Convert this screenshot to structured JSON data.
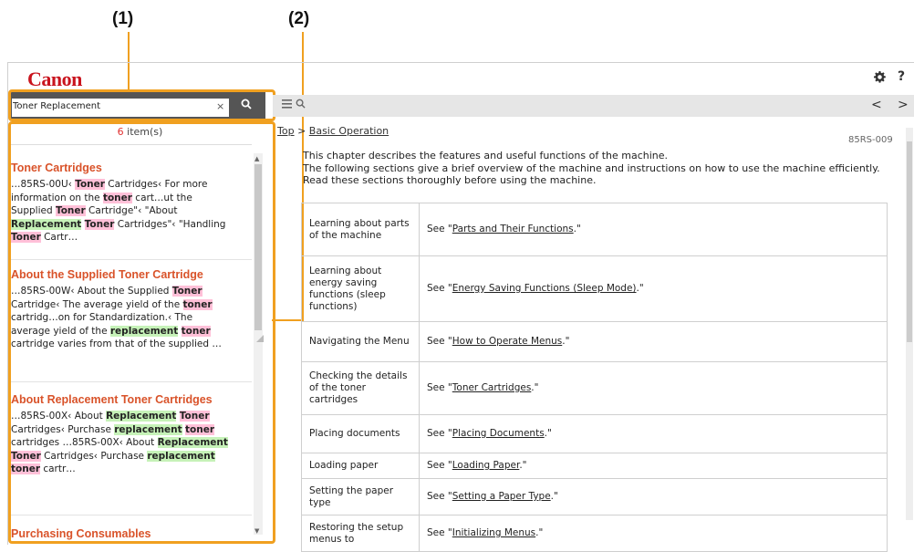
{
  "callouts": {
    "one": "(1)",
    "two": "(2)"
  },
  "header": {
    "logo": "Canon",
    "settings_icon": "gear-icon",
    "help_label": "?"
  },
  "search": {
    "value": "Toner Replacement",
    "clear_label": "×",
    "button_icon": "search-icon"
  },
  "toolbar": {
    "list_icon": "list-icon",
    "search_icon": "search-icon",
    "prev_label": "<",
    "next_label": ">"
  },
  "results": {
    "count": "6",
    "count_suffix": " item(s)",
    "items": [
      {
        "title": "Toner Cartridges",
        "snippet": [
          [
            "…85RS-00U‹ ",
            ""
          ],
          [
            "Toner",
            "t"
          ],
          [
            " Cartridges‹ For more information on the ",
            ""
          ],
          [
            "toner",
            "t"
          ],
          [
            " cart…ut the Supplied ",
            ""
          ],
          [
            "Toner",
            "t"
          ],
          [
            " Cartridge\"‹ \"About ",
            ""
          ],
          [
            "Replacement",
            "r"
          ],
          [
            " ",
            ""
          ],
          [
            "Toner",
            "t"
          ],
          [
            " Cartridges\"‹ \"Handling ",
            ""
          ],
          [
            "Toner",
            "t"
          ],
          [
            " Cartr…",
            ""
          ]
        ]
      },
      {
        "title": "About the Supplied Toner Cartridge",
        "snippet": [
          [
            "…85RS-00W‹ About the Supplied ",
            ""
          ],
          [
            "Toner",
            "t"
          ],
          [
            " Cartridge‹ The average yield of the ",
            ""
          ],
          [
            "toner",
            "t"
          ],
          [
            " cartridg…on for Standardization.‹ The average yield of the ",
            ""
          ],
          [
            "replacement",
            "r"
          ],
          [
            " ",
            ""
          ],
          [
            "toner",
            "t"
          ],
          [
            " cartridge varies from that of the supplied …",
            ""
          ]
        ]
      },
      {
        "title": "About Replacement Toner Cartridges",
        "snippet": [
          [
            "…85RS-00X‹ About ",
            ""
          ],
          [
            "Replacement",
            "r"
          ],
          [
            " ",
            ""
          ],
          [
            "Toner",
            "t"
          ],
          [
            " Cartridges‹ Purchase ",
            ""
          ],
          [
            "replacement",
            "r"
          ],
          [
            " ",
            ""
          ],
          [
            "toner",
            "t"
          ],
          [
            " cartridges …85RS-00X‹ About ",
            ""
          ],
          [
            "Replacement",
            "r"
          ],
          [
            " ",
            ""
          ],
          [
            "Toner",
            "t"
          ],
          [
            " Cartridges‹ Purchase ",
            ""
          ],
          [
            "replacement",
            "r"
          ],
          [
            " ",
            ""
          ],
          [
            "toner",
            "t"
          ],
          [
            " cartr…",
            ""
          ]
        ]
      },
      {
        "title": "Purchasing Consumables",
        "snippet": []
      }
    ]
  },
  "content": {
    "breadcrumb_top": "Top",
    "breadcrumb_sep": ">",
    "breadcrumb_current": "Basic Operation",
    "doc_id": "85RS-009",
    "intro_line1": "This chapter describes the features and useful functions of the machine.",
    "intro_line2": "The following sections give a brief overview of the machine and instructions on how to use the machine efficiently. Read these sections thoroughly before using the machine.",
    "table": [
      {
        "task": "Learning about parts of the machine",
        "link": "Parts and Their Functions"
      },
      {
        "task": "Learning about energy saving functions (sleep functions)",
        "link": "Energy Saving Functions (Sleep Mode)"
      },
      {
        "task": "Navigating the Menu",
        "link": "How to Operate Menus"
      },
      {
        "task": "Checking the details of the toner cartridges",
        "link": "Toner Cartridges"
      },
      {
        "task": "Placing documents",
        "link": "Placing Documents"
      },
      {
        "task": "Loading paper",
        "link": "Loading Paper"
      },
      {
        "task": "Setting the paper type",
        "link": "Setting a Paper Type"
      },
      {
        "task": "Restoring the setup menus to",
        "link": "Initializing Menus"
      }
    ],
    "see_prefix": "See \"",
    "see_suffix": ".\""
  },
  "colors": {
    "brand": "#c9141e",
    "highlight_frame": "#f0a020",
    "term_highlight": "#ffc0d8",
    "replacement_highlight": "#c6f2b8",
    "result_title": "#d9532a"
  }
}
